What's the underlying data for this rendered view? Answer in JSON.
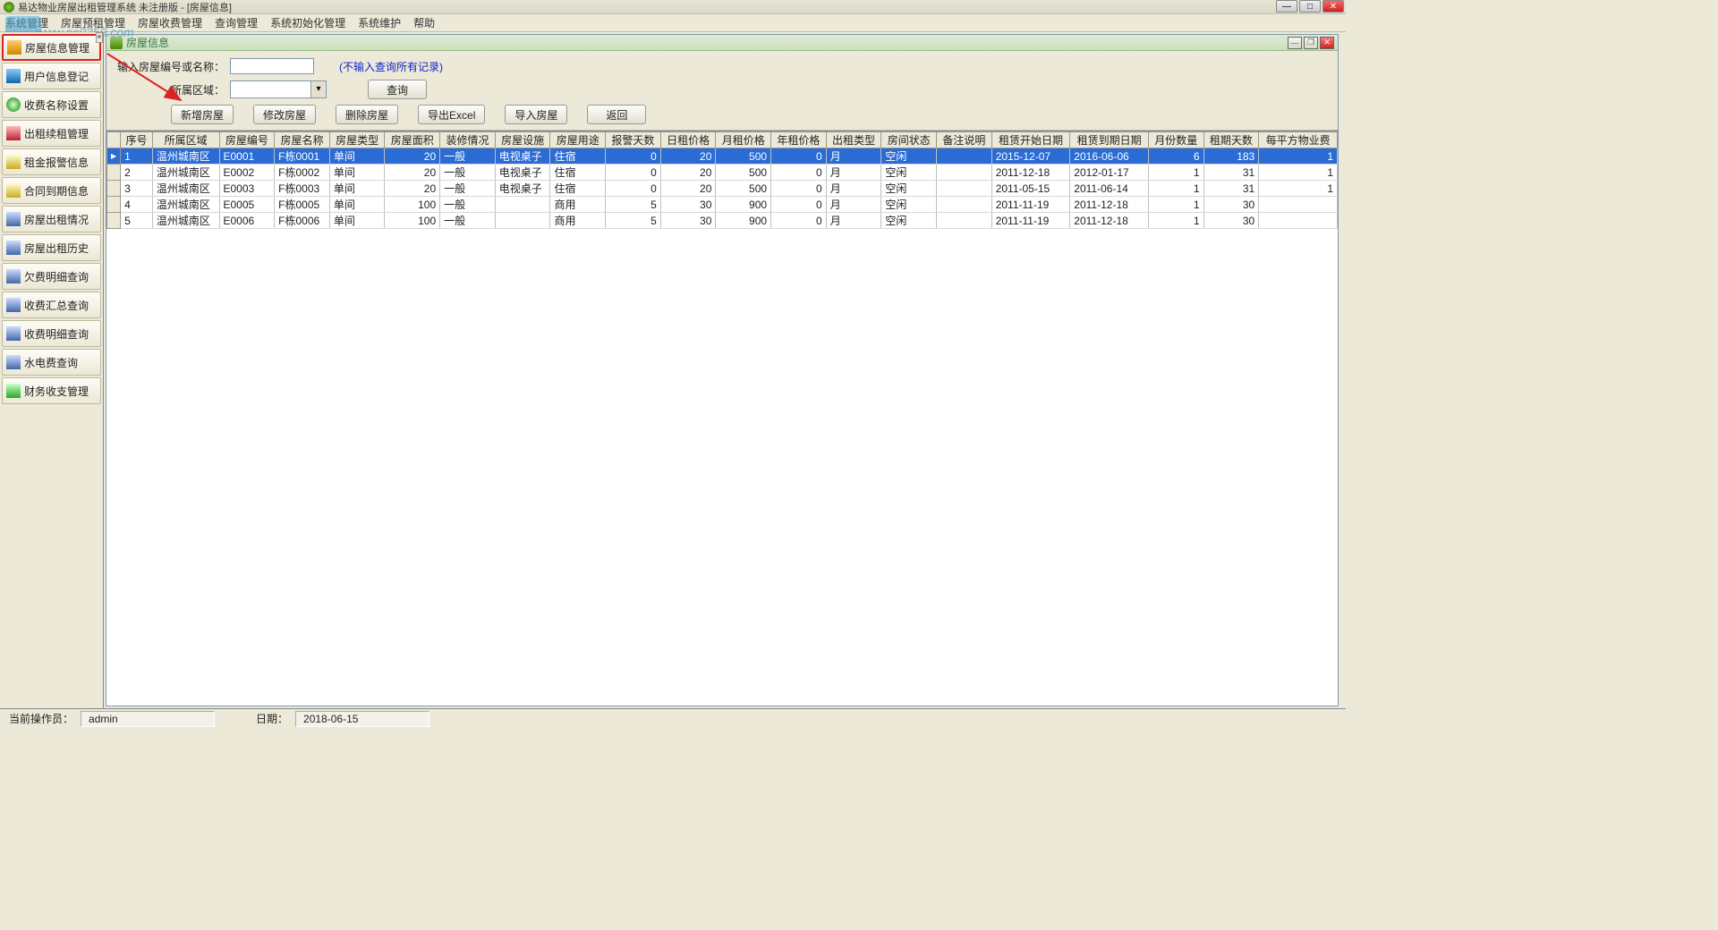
{
  "window": {
    "title": "易达物业房屋出租管理系统 未注册版  - [房屋信息]"
  },
  "menu": [
    "系统管理",
    "房屋预租管理",
    "房屋收费管理",
    "查询管理",
    "系统初始化管理",
    "系统维护",
    "帮助"
  ],
  "watermark": "www.pc0359.com",
  "sidebar": {
    "items": [
      {
        "label": "房屋信息管理"
      },
      {
        "label": "用户信息登记"
      },
      {
        "label": "收费名称设置"
      },
      {
        "label": "出租续租管理"
      },
      {
        "label": "租金报警信息"
      },
      {
        "label": "合同到期信息"
      },
      {
        "label": "房屋出租情况"
      },
      {
        "label": "房屋出租历史"
      },
      {
        "label": "欠费明细查询"
      },
      {
        "label": "收费汇总查询"
      },
      {
        "label": "收费明细查询"
      },
      {
        "label": "水电费查询"
      },
      {
        "label": "财务收支管理"
      }
    ]
  },
  "child": {
    "title": "房屋信息"
  },
  "search": {
    "name_label": "输入房屋编号或名称：",
    "area_label": "所属区域：",
    "hint": "(不输入查询所有记录)",
    "query_btn": "查询",
    "btns": [
      "新增房屋",
      "修改房屋",
      "删除房屋",
      "导出Excel",
      "导入房屋",
      "返回"
    ]
  },
  "table": {
    "cols": [
      "序号",
      "所属区域",
      "房屋编号",
      "房屋名称",
      "房屋类型",
      "房屋面积",
      "装修情况",
      "房屋设施",
      "房屋用途",
      "报警天数",
      "日租价格",
      "月租价格",
      "年租价格",
      "出租类型",
      "房间状态",
      "备注说明",
      "租赁开始日期",
      "租赁到期日期",
      "月份数量",
      "租期天数",
      "每平方物业费"
    ],
    "rows": [
      {
        "n": "1",
        "area": "温州城南区",
        "code": "E0001",
        "name": "F栋0001",
        "type": "单间",
        "sqm": "20",
        "deco": "一般",
        "fac": "电视桌子",
        "use": "住宿",
        "warn": "0",
        "dp": "20",
        "mp": "500",
        "yp": "0",
        "rt": "月",
        "st": "空闲",
        "note": "",
        "start": "2015-12-07",
        "end": "2016-06-06",
        "months": "6",
        "days": "183",
        "fee": "1"
      },
      {
        "n": "2",
        "area": "温州城南区",
        "code": "E0002",
        "name": "F栋0002",
        "type": "单间",
        "sqm": "20",
        "deco": "一般",
        "fac": "电视桌子",
        "use": "住宿",
        "warn": "0",
        "dp": "20",
        "mp": "500",
        "yp": "0",
        "rt": "月",
        "st": "空闲",
        "note": "",
        "start": "2011-12-18",
        "end": "2012-01-17",
        "months": "1",
        "days": "31",
        "fee": "1"
      },
      {
        "n": "3",
        "area": "温州城南区",
        "code": "E0003",
        "name": "F栋0003",
        "type": "单间",
        "sqm": "20",
        "deco": "一般",
        "fac": "电视桌子",
        "use": "住宿",
        "warn": "0",
        "dp": "20",
        "mp": "500",
        "yp": "0",
        "rt": "月",
        "st": "空闲",
        "note": "",
        "start": "2011-05-15",
        "end": "2011-06-14",
        "months": "1",
        "days": "31",
        "fee": "1"
      },
      {
        "n": "4",
        "area": "温州城南区",
        "code": "E0005",
        "name": "F栋0005",
        "type": "单间",
        "sqm": "100",
        "deco": "一般",
        "fac": "",
        "use": "商用",
        "warn": "5",
        "dp": "30",
        "mp": "900",
        "yp": "0",
        "rt": "月",
        "st": "空闲",
        "note": "",
        "start": "2011-11-19",
        "end": "2011-12-18",
        "months": "1",
        "days": "30",
        "fee": ""
      },
      {
        "n": "5",
        "area": "温州城南区",
        "code": "E0006",
        "name": "F栋0006",
        "type": "单间",
        "sqm": "100",
        "deco": "一般",
        "fac": "",
        "use": "商用",
        "warn": "5",
        "dp": "30",
        "mp": "900",
        "yp": "0",
        "rt": "月",
        "st": "空闲",
        "note": "",
        "start": "2011-11-19",
        "end": "2011-12-18",
        "months": "1",
        "days": "30",
        "fee": ""
      }
    ]
  },
  "status": {
    "op_label": "当前操作员：",
    "op_value": "admin",
    "date_label": "日期：",
    "date_value": "2018-06-15"
  }
}
